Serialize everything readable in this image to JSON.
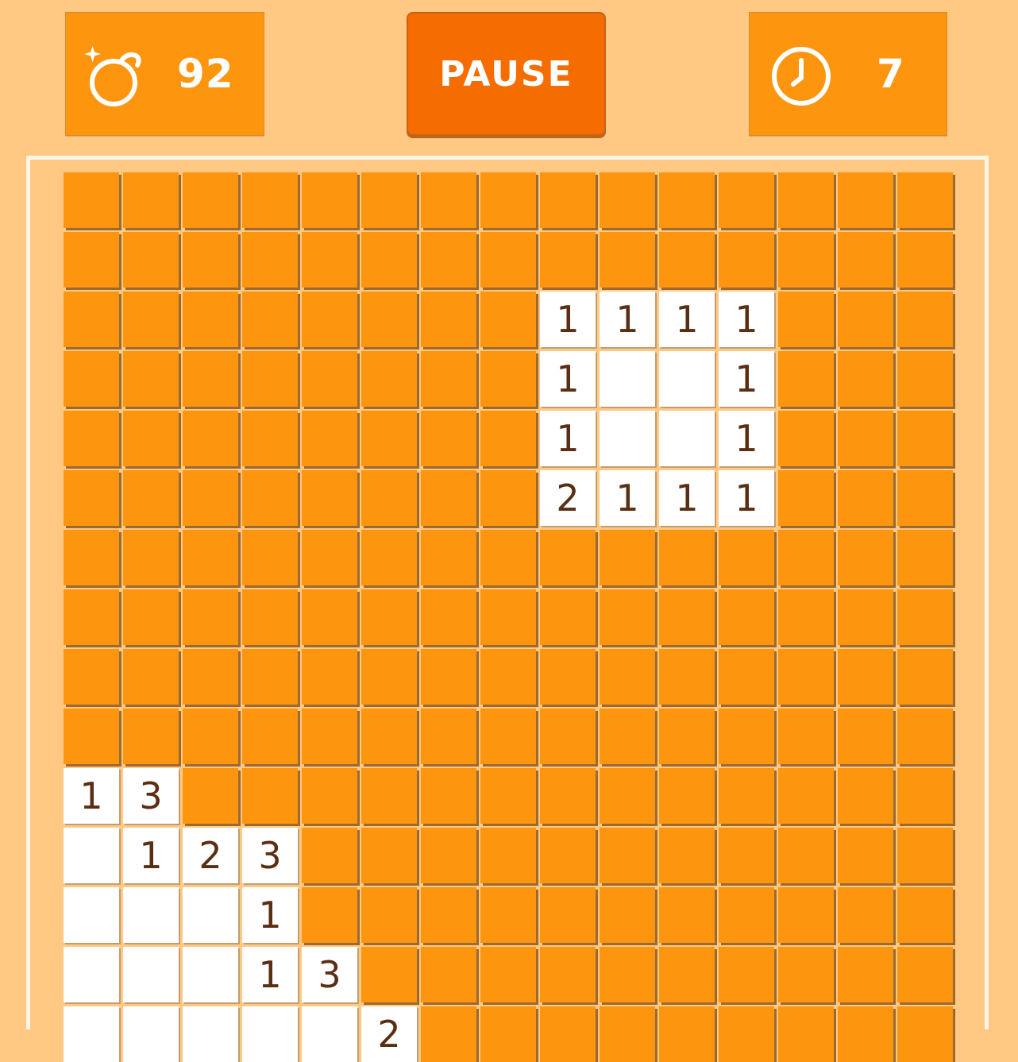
{
  "header": {
    "mines_icon": "bomb-sparkle-icon",
    "mines_remaining": "92",
    "pause_label": "PAUSE",
    "timer_icon": "clock-icon",
    "elapsed_seconds": "7"
  },
  "colors": {
    "background": "#ffc984",
    "hidden_tile": "#fd950f",
    "pause_button": "#f56c00",
    "revealed_tile": "#ffffff",
    "number_text": "#5a2e12"
  },
  "board": {
    "columns": 15,
    "visible_rows": 15,
    "rows": [
      "###############",
      "###############",
      "########1111###",
      "########1..1###",
      "########1..1###",
      "########2111###",
      "###############",
      "###############",
      "###############",
      "###############",
      "13#############",
      ".123###########",
      "...1###########",
      "...13##########",
      ".....2#########"
    ]
  }
}
